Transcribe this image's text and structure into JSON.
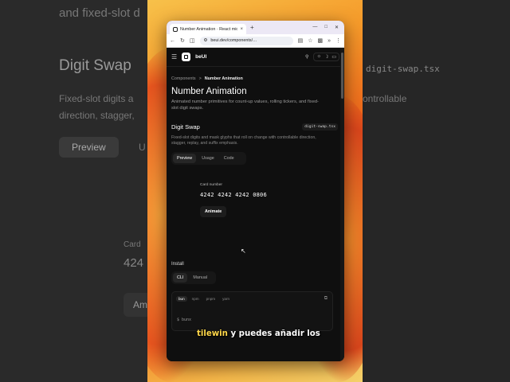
{
  "background_left": {
    "line1": "and fixed-slot d",
    "title": "Digit Swap",
    "desc1": "Fixed-slot digits a",
    "desc2": "direction, stagger,",
    "preview": "Preview",
    "u": "U",
    "card": "Card",
    "num": "424",
    "am": "Am"
  },
  "background_right": {
    "file": "digit-swap.tsx",
    "desc": "ontrollable"
  },
  "browser": {
    "tab_title": "Number Animation · React micr…",
    "tab_close": "×",
    "new_tab": "+",
    "url": "beui.dev/components/…"
  },
  "site": {
    "brand": "beUI"
  },
  "breadcrumb": {
    "root": "Components",
    "sep": ">",
    "current": "Number Animation"
  },
  "page": {
    "title": "Number Animation",
    "lead": "Animated number primitives for count-up values, rolling tickers, and fixed-slot digit swaps."
  },
  "section": {
    "title": "Digit Swap",
    "file": "digit-swap.tsx",
    "desc": "Fixed-slot digits and mask glyphs that roll on change with controllable direction, stagger, replay, and suffix emphasis.",
    "tabs": [
      "Preview",
      "Usage",
      "Code"
    ]
  },
  "preview": {
    "card_label": "Card number",
    "card_number": "4242 4242 4242 0806",
    "animate": "Animate"
  },
  "install": {
    "label": "Install",
    "tabs": [
      "CLI",
      "Manual"
    ],
    "pm": [
      "bun",
      "npm",
      "pnpm",
      "yarn"
    ],
    "cmd_prefix": "$ bunx"
  },
  "caption": {
    "highlight": "tilewin",
    "rest": " y puedes añadir los"
  }
}
